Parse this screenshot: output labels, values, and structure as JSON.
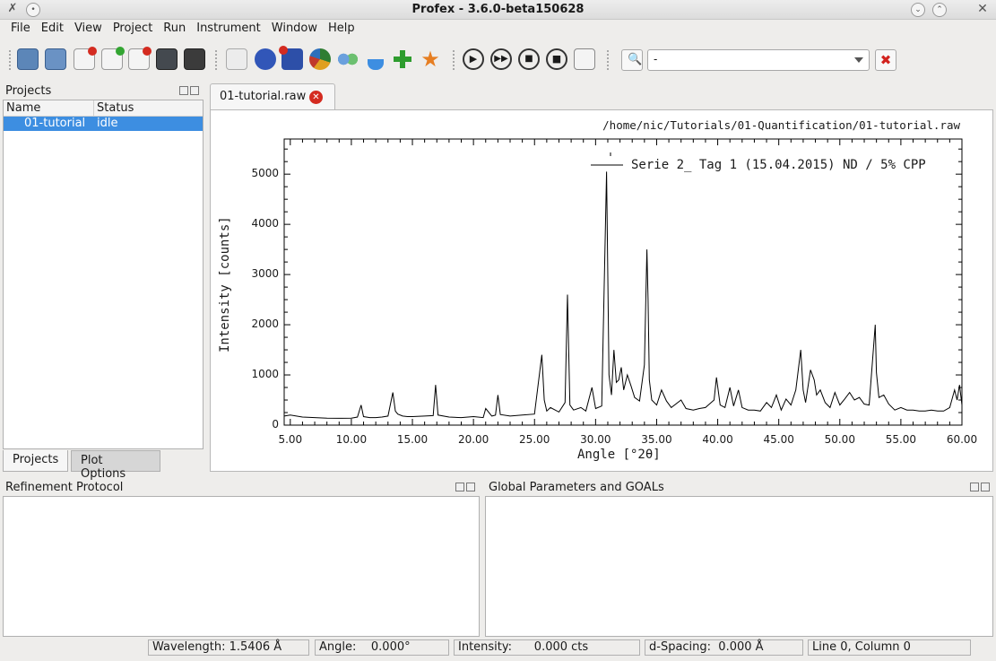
{
  "window": {
    "title": "Profex - 3.6.0-beta150628"
  },
  "menu": [
    "File",
    "Edit",
    "View",
    "Project",
    "Run",
    "Instrument",
    "Window",
    "Help"
  ],
  "toolbar": {
    "icons": [
      "new-project-icon",
      "open-project-icon",
      "close-project-icon",
      "add-file-icon",
      "remove-file-icon",
      "save-icon",
      "edit-icon",
      "print-icon",
      "export-icon",
      "close-plot-icon",
      "pie-chart-icon",
      "molecule-icon",
      "flask-icon",
      "add-phase-icon",
      "favorite-star-icon",
      "run-icon",
      "fast-forward-icon",
      "stop-icon",
      "stop-all-icon",
      "log-icon"
    ],
    "search_combo_value": "-"
  },
  "projects_panel": {
    "title": "Projects",
    "columns": [
      "Name",
      "Status"
    ],
    "rows": [
      {
        "name": "01-tutorial",
        "status": "idle"
      }
    ],
    "tabs": [
      "Projects",
      "Plot Options"
    ]
  },
  "plot": {
    "tab_label": "01-tutorial.raw",
    "file_path": "/home/nic/Tutorials/01-Quantification/01-tutorial.raw"
  },
  "chart_data": {
    "type": "line",
    "title": "",
    "xlabel": "Angle [°2θ]",
    "ylabel": "Intensity [counts]",
    "xlim": [
      4.5,
      60.0
    ],
    "ylim": [
      0,
      5700
    ],
    "x_ticks": [
      "5.00",
      "10.00",
      "15.00",
      "20.00",
      "25.00",
      "30.00",
      "35.00",
      "40.00",
      "45.00",
      "50.00",
      "55.00",
      "60.00"
    ],
    "y_ticks": [
      "0",
      "1000",
      "2000",
      "3000",
      "4000",
      "5000"
    ],
    "grid": false,
    "legend_position": "top-right",
    "series": [
      {
        "name": "Serie 2_ Tag 1 (15.04.2015) ND / 5% CPP",
        "x": [
          4.5,
          5.0,
          6.0,
          7.0,
          8.0,
          9.0,
          10.0,
          10.5,
          10.8,
          11.0,
          11.5,
          12.0,
          12.5,
          13.0,
          13.4,
          13.6,
          13.8,
          14.2,
          14.6,
          15.0,
          16.0,
          16.7,
          16.9,
          17.1,
          18.0,
          19.0,
          20.0,
          20.8,
          21.0,
          21.5,
          21.8,
          22.0,
          22.2,
          23.0,
          24.0,
          25.0,
          25.6,
          25.8,
          26.0,
          26.3,
          27.0,
          27.5,
          27.7,
          27.9,
          28.2,
          28.8,
          29.2,
          29.7,
          30.0,
          30.5,
          30.9,
          31.0,
          31.1,
          31.3,
          31.5,
          31.7,
          31.9,
          32.1,
          32.3,
          32.6,
          32.9,
          33.2,
          33.6,
          34.0,
          34.2,
          34.3,
          34.4,
          34.6,
          35.0,
          35.4,
          35.8,
          36.2,
          37.0,
          37.4,
          38.0,
          38.5,
          39.0,
          39.7,
          39.9,
          40.2,
          40.6,
          41.0,
          41.3,
          41.7,
          42.0,
          42.5,
          43.0,
          43.5,
          44.0,
          44.4,
          44.8,
          45.2,
          45.6,
          46.0,
          46.4,
          46.8,
          47.0,
          47.2,
          47.6,
          47.9,
          48.1,
          48.4,
          48.8,
          49.2,
          49.6,
          50.0,
          50.4,
          50.8,
          51.2,
          51.6,
          52.0,
          52.4,
          52.9,
          53.0,
          53.2,
          53.6,
          54.0,
          54.5,
          55.0,
          55.5,
          56.0,
          56.5,
          57.0,
          57.5,
          58.0,
          58.5,
          59.0,
          59.4,
          59.6,
          59.8,
          60.0
        ],
        "y": [
          180,
          200,
          160,
          150,
          140,
          135,
          140,
          160,
          400,
          170,
          150,
          150,
          160,
          180,
          650,
          280,
          220,
          180,
          170,
          170,
          180,
          190,
          800,
          200,
          160,
          150,
          170,
          150,
          330,
          180,
          200,
          600,
          210,
          180,
          200,
          220,
          1400,
          500,
          280,
          350,
          260,
          450,
          2600,
          400,
          300,
          350,
          280,
          750,
          330,
          380,
          5050,
          2950,
          1000,
          600,
          1500,
          850,
          900,
          1150,
          700,
          1000,
          780,
          550,
          480,
          1200,
          3500,
          2500,
          900,
          500,
          400,
          700,
          480,
          350,
          500,
          330,
          300,
          330,
          350,
          500,
          950,
          400,
          350,
          750,
          380,
          700,
          350,
          300,
          300,
          280,
          450,
          350,
          600,
          300,
          520,
          400,
          700,
          1500,
          700,
          450,
          1100,
          900,
          600,
          700,
          450,
          350,
          650,
          400,
          520,
          650,
          500,
          550,
          420,
          400,
          2000,
          1050,
          550,
          600,
          420,
          300,
          350,
          300,
          300,
          280,
          280,
          300,
          280,
          280,
          350,
          700,
          500,
          800,
          400
        ]
      }
    ]
  },
  "refinement_panel": {
    "title": "Refinement Protocol"
  },
  "global_panel": {
    "title": "Global Parameters and GOALs"
  },
  "status": {
    "wavelength": "Wavelength: 1.5406 Å",
    "angle": "Angle:    0.000°",
    "intensity": "Intensity:      0.000 cts",
    "dspacing": "d-Spacing:  0.000 Å",
    "cursor": "Line 0, Column 0"
  },
  "colors": {
    "selection": "#3d8ee1",
    "close_red": "#d42b20"
  }
}
